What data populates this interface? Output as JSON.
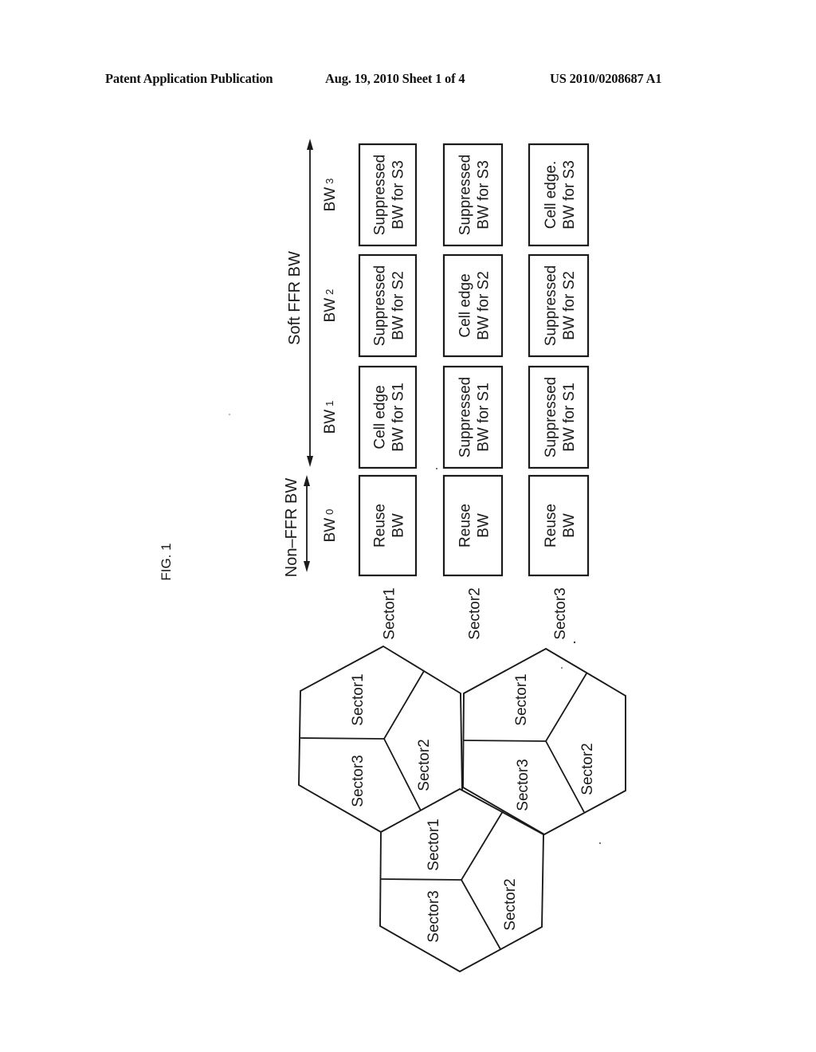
{
  "header": {
    "publication": "Patent Application Publication",
    "date_sheet": "Aug. 19, 2010  Sheet 1 of 4",
    "number": "US 2010/0208687 A1"
  },
  "figure": {
    "label": "FIG. 1",
    "soft_ffr_label": "Soft FFR BW",
    "non_ffr_label": "Non–FFR BW",
    "bands": [
      {
        "name": "BW",
        "sub": "0"
      },
      {
        "name": "BW",
        "sub": "1"
      },
      {
        "name": "BW",
        "sub": "2"
      },
      {
        "name": "BW",
        "sub": "3"
      }
    ],
    "sectors": [
      {
        "label": "Sector1",
        "cells": [
          {
            "line1": "Reuse",
            "line2": "BW"
          },
          {
            "line1": "Cell edge",
            "line2": "BW for S1"
          },
          {
            "line1": "Suppressed",
            "line2": "BW for S2"
          },
          {
            "line1": "Suppressed",
            "line2": "BW for S3"
          }
        ]
      },
      {
        "label": "Sector2",
        "cells": [
          {
            "line1": "Reuse",
            "line2": "BW"
          },
          {
            "line1": "Suppressed",
            "line2": "BW for S1"
          },
          {
            "line1": "Cell edge",
            "line2": "BW for S2"
          },
          {
            "line1": "Suppressed",
            "line2": "BW for S3"
          }
        ]
      },
      {
        "label": "Sector3",
        "cells": [
          {
            "line1": "Reuse",
            "line2": "BW"
          },
          {
            "line1": "Suppressed",
            "line2": "BW for S1"
          },
          {
            "line1": "Suppressed",
            "line2": "BW for S2"
          },
          {
            "line1": "Cell edge.",
            "line2": "BW for S3"
          }
        ]
      }
    ],
    "cells": [
      {
        "sector_labels": [
          "Sector1",
          "Sector2",
          "Sector3"
        ]
      },
      {
        "sector_labels": [
          "Sector1",
          "Sector2",
          "Sector3"
        ]
      },
      {
        "sector_labels": [
          "Sector1",
          "Sector2",
          "Sector3"
        ]
      }
    ]
  }
}
